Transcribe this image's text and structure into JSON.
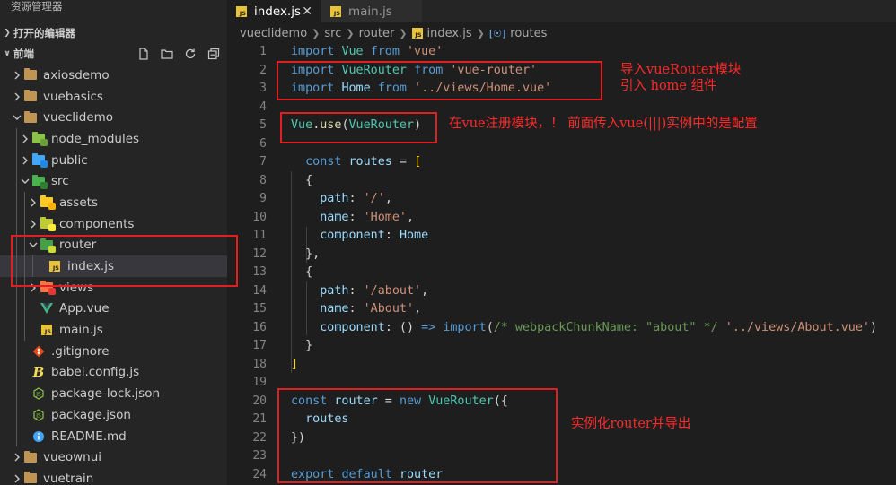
{
  "sidebar": {
    "title": "资源管理器",
    "open_editors_label": "打开的编辑器",
    "workspace_label": "前端",
    "tree": [
      {
        "label": "axiosdemo",
        "depth": 0,
        "twisty": "closed",
        "icon": "folder-icon"
      },
      {
        "label": "vuebasics",
        "depth": 0,
        "twisty": "closed",
        "icon": "folder-icon"
      },
      {
        "label": "vueclidemo",
        "depth": 0,
        "twisty": "open",
        "icon": "folder-icon"
      },
      {
        "label": "node_modules",
        "depth": 1,
        "twisty": "closed",
        "icon": "node-modules-folder-icon"
      },
      {
        "label": "public",
        "depth": 1,
        "twisty": "closed",
        "icon": "public-folder-icon"
      },
      {
        "label": "src",
        "depth": 1,
        "twisty": "open",
        "icon": "src-folder-icon"
      },
      {
        "label": "assets",
        "depth": 2,
        "twisty": "closed",
        "icon": "assets-folder-icon"
      },
      {
        "label": "components",
        "depth": 2,
        "twisty": "closed",
        "icon": "components-folder-icon"
      },
      {
        "label": "router",
        "depth": 2,
        "twisty": "open",
        "icon": "router-folder-icon"
      },
      {
        "label": "index.js",
        "depth": 3,
        "twisty": "none",
        "icon": "js-file-icon",
        "selected": true
      },
      {
        "label": "views",
        "depth": 2,
        "twisty": "closed",
        "icon": "views-folder-icon"
      },
      {
        "label": "App.vue",
        "depth": 2,
        "twisty": "none",
        "icon": "vue-file-icon"
      },
      {
        "label": "main.js",
        "depth": 2,
        "twisty": "none",
        "icon": "js-file-icon"
      },
      {
        "label": ".gitignore",
        "depth": 1,
        "twisty": "none",
        "icon": "git-file-icon"
      },
      {
        "label": "babel.config.js",
        "depth": 1,
        "twisty": "none",
        "icon": "babel-file-icon"
      },
      {
        "label": "package-lock.json",
        "depth": 1,
        "twisty": "none",
        "icon": "npm-file-icon"
      },
      {
        "label": "package.json",
        "depth": 1,
        "twisty": "none",
        "icon": "npm-file-icon"
      },
      {
        "label": "README.md",
        "depth": 1,
        "twisty": "none",
        "icon": "info-file-icon"
      },
      {
        "label": "vueownui",
        "depth": 0,
        "twisty": "closed",
        "icon": "folder-icon"
      },
      {
        "label": "vuetrain",
        "depth": 0,
        "twisty": "closed",
        "icon": "folder-icon"
      }
    ]
  },
  "tabs": [
    {
      "label": "index.js",
      "active": true,
      "badge": "JS"
    },
    {
      "label": "main.js",
      "active": false,
      "badge": "JS"
    }
  ],
  "breadcrumb": [
    "vueclidemo",
    "src",
    "router",
    "index.js",
    "routes"
  ],
  "code_lines": [
    "import Vue from 'vue'",
    "import VueRouter from 'vue-router'",
    "import Home from '../views/Home.vue'",
    "",
    "Vue.use(VueRouter)",
    "",
    "  const routes = [",
    "  {",
    "    path: '/',",
    "    name: 'Home',",
    "    component: Home",
    "  },",
    "  {",
    "    path: '/about',",
    "    name: 'About',",
    "    component: () => import(/* webpackChunkName: \"about\" */ '../views/About.vue')",
    "  }",
    "]",
    "",
    "const router = new VueRouter({",
    "  routes",
    "})",
    "",
    "export default router"
  ],
  "annotations": {
    "import_note_1": "导入vueRouter模块",
    "import_note_2": "引入 home 组件",
    "use_note": "在vue注册模块，！ 前面传入vue(|||)实例中的是配置",
    "router_note": "实例化router并导出"
  },
  "colors": {
    "annotation": "#e02020",
    "keyword": "#569cd6",
    "string": "#ce9178"
  }
}
